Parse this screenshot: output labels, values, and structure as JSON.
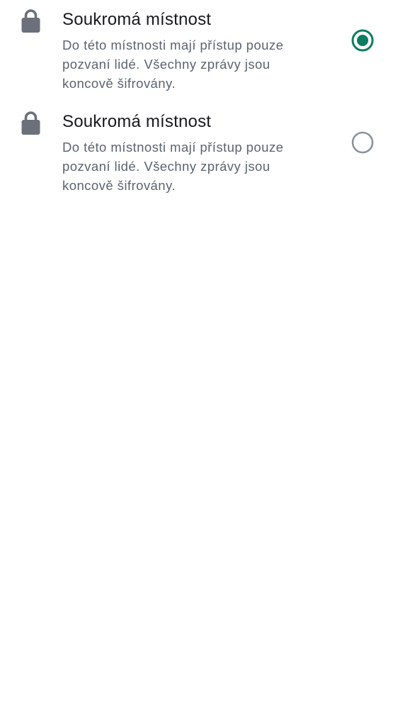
{
  "colors": {
    "accent": "#0b7d61",
    "icon": "#6b707a",
    "title_text": "#17191c",
    "description_text": "#5c6470",
    "radio_unselected": "#8d939c"
  },
  "options": [
    {
      "icon": "lock-icon",
      "title": "Soukromá místnost",
      "description": "Do této místnosti mají přístup pouze pozvaní lidé. Všechny zprávy jsou koncově šifrovány.",
      "selected": true
    },
    {
      "icon": "lock-icon",
      "title": "Soukromá místnost",
      "description": "Do této místnosti mají přístup pouze pozvaní lidé. Všechny zprávy jsou koncově šifrovány.",
      "selected": false
    }
  ]
}
